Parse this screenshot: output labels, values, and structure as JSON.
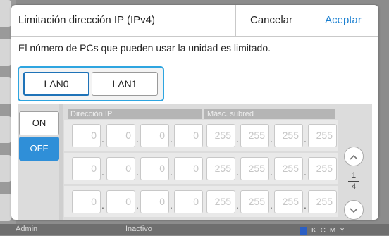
{
  "background": {
    "status_user": "Admin",
    "status_state": "Inactivo",
    "ink_colors": [
      "#2b5fc4",
      "#222222",
      "#20a0d8",
      "#d040a0",
      "#e0c020"
    ],
    "ink_letters": [
      "K",
      "C",
      "M",
      "Y"
    ]
  },
  "dialog": {
    "title": "Limitación dirección IP (IPv4)",
    "cancel_label": "Cancelar",
    "accept_label": "Aceptar",
    "description": "El número de PCs que pueden usar la unidad es limitado."
  },
  "lan_tabs": [
    {
      "label": "LAN0",
      "selected": true
    },
    {
      "label": "LAN1",
      "selected": false
    }
  ],
  "toggle": {
    "on_label": "ON",
    "off_label": "OFF",
    "selected": "OFF"
  },
  "columns": {
    "ip_header": "Dirección IP",
    "mask_header": "Másc. subred"
  },
  "rows": [
    {
      "ip": [
        "0",
        "0",
        "0",
        "0"
      ],
      "mask": [
        "255",
        "255",
        "255",
        "255"
      ]
    },
    {
      "ip": [
        "0",
        "0",
        "0",
        "0"
      ],
      "mask": [
        "255",
        "255",
        "255",
        "255"
      ]
    },
    {
      "ip": [
        "0",
        "0",
        "0",
        "0"
      ],
      "mask": [
        "255",
        "255",
        "255",
        "255"
      ]
    }
  ],
  "pagination": {
    "current": "1",
    "total": "4"
  },
  "accent_color": "#1a7fd0"
}
